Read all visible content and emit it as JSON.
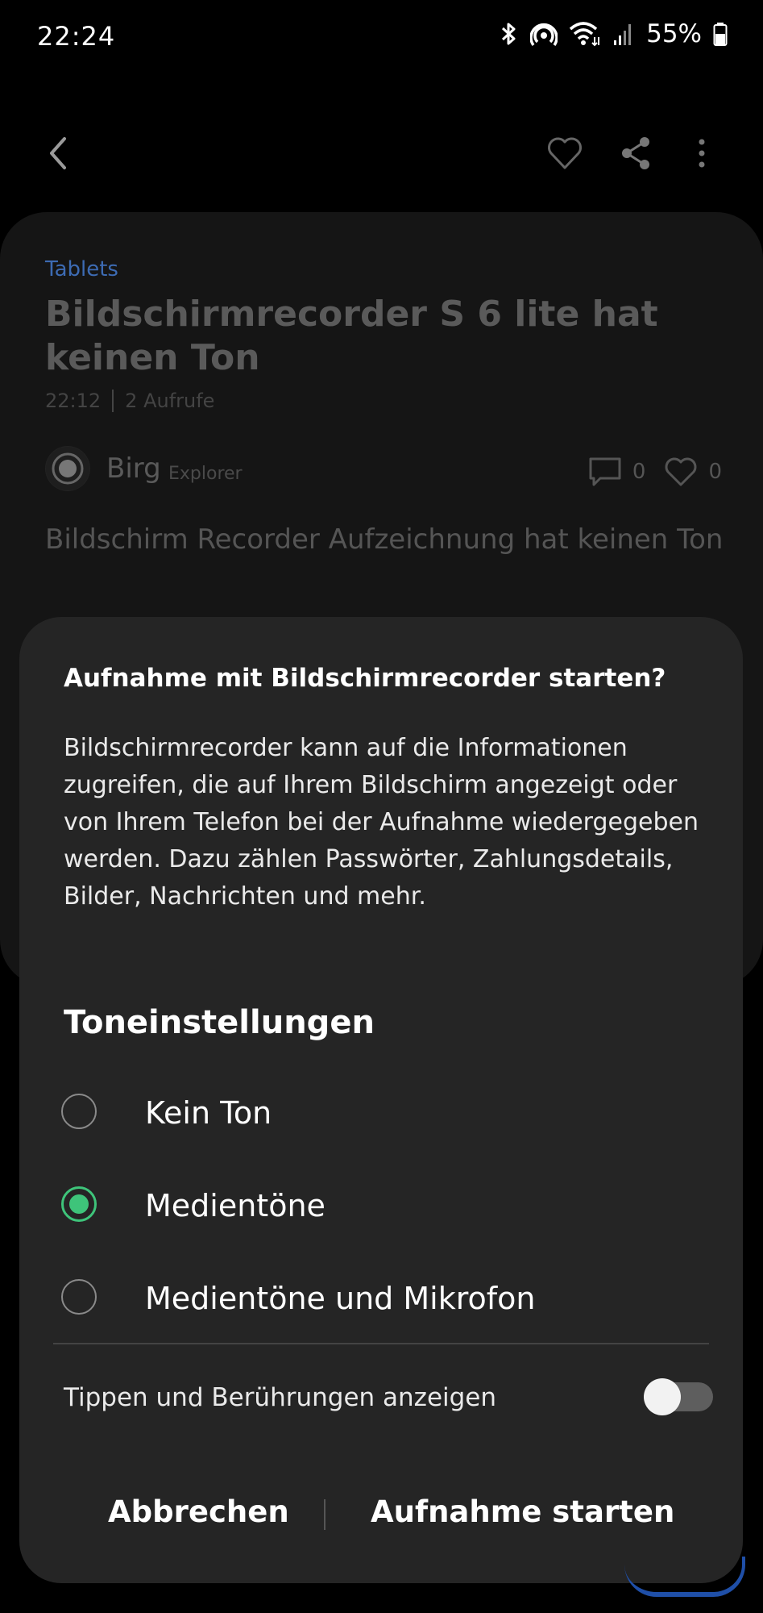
{
  "status_bar": {
    "time": "22:24",
    "battery": "55%",
    "icons": [
      "bluetooth-icon",
      "hotspot-icon",
      "wifi-icon",
      "signal-icon",
      "battery-icon"
    ]
  },
  "appbar": {
    "icons": [
      "back-icon",
      "heart-icon",
      "share-icon",
      "more-icon"
    ]
  },
  "post": {
    "category": "Tablets",
    "title": "Bildschirmrecorder S 6 lite hat keinen Ton",
    "time": "22:12",
    "views": "2 Aufrufe",
    "author": "Birg",
    "author_role": "Explorer",
    "comments": "0",
    "likes": "0",
    "body": "Bildschirm Recorder Aufzeichnung hat keinen Ton"
  },
  "dialog": {
    "title": "Aufnahme mit Bildschirmrecorder starten?",
    "description": "Bildschirmrecorder kann auf die Informationen zugreifen, die auf Ihrem Bildschirm angezeigt oder von Ihrem Telefon bei der Aufnahme wiedergegeben werden. Dazu zählen Passwörter, Zahlungsdetails, Bilder, Nachrichten und mehr.",
    "sound_heading": "Toneinstellungen",
    "options": [
      {
        "label": "Kein Ton",
        "selected": false
      },
      {
        "label": "Medientöne",
        "selected": true
      },
      {
        "label": "Medientöne und Mikrofon",
        "selected": false
      }
    ],
    "touch_label": "Tippen und Berührungen anzeigen",
    "touch_enabled": false,
    "cancel_label": "Abbrechen",
    "start_label": "Aufnahme starten"
  },
  "colors": {
    "accent_green": "#3ec47a",
    "category_blue": "#3d6bb3",
    "dialog_bg": "#252525"
  }
}
